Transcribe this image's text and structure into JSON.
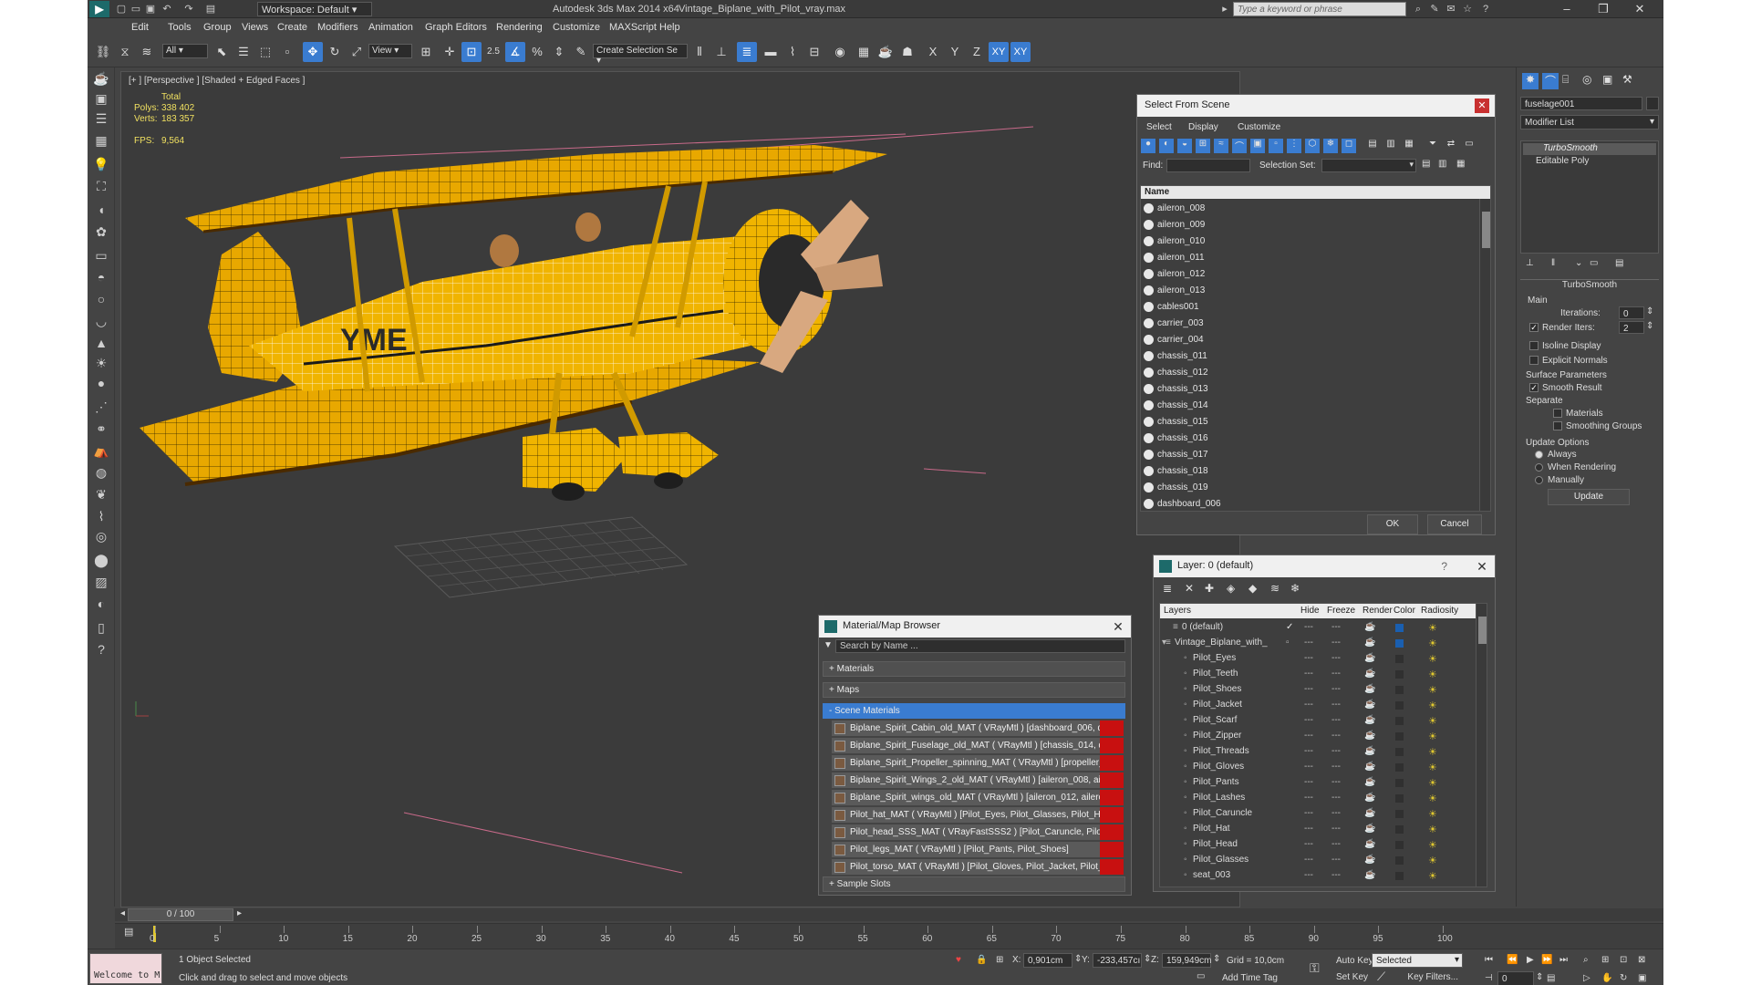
{
  "title_bar": {
    "workspace": "Workspace: Default",
    "app_title": "Autodesk 3ds Max  2014 x64",
    "file_name": "Vintage_Biplane_with_Pilot_vray.max",
    "search_placeholder": "Type a keyword or phrase"
  },
  "menu": [
    "Edit",
    "Tools",
    "Group",
    "Views",
    "Create",
    "Modifiers",
    "Animation",
    "Graph Editors",
    "Rendering",
    "Customize",
    "MAXScript",
    "Help"
  ],
  "toolbar": {
    "filter": "All",
    "ref_coord": "View",
    "snap_value": "2.5",
    "named_set": "Create Selection Se",
    "axis_labels": [
      "X",
      "Y",
      "Z",
      "XY",
      "XY"
    ]
  },
  "viewport": {
    "label": "[+ ] [Perspective ] [Shaded + Edged Faces ]",
    "stats": {
      "total_label": "Total",
      "polys_label": "Polys:",
      "polys": "338 402",
      "verts_label": "Verts:",
      "verts": "183 357",
      "fps_label": "FPS:",
      "fps": "9,564"
    },
    "hull_text": "YME"
  },
  "select_from_scene": {
    "title": "Select From Scene",
    "menu": [
      "Select",
      "Display",
      "Customize"
    ],
    "find_label": "Find:",
    "selection_set_label": "Selection Set:",
    "column": "Name",
    "items": [
      "aileron_008",
      "aileron_009",
      "aileron_010",
      "aileron_011",
      "aileron_012",
      "aileron_013",
      "cables001",
      "carrier_003",
      "carrier_004",
      "chassis_011",
      "chassis_012",
      "chassis_013",
      "chassis_014",
      "chassis_015",
      "chassis_016",
      "chassis_017",
      "chassis_018",
      "chassis_019",
      "dashboard_006"
    ],
    "ok": "OK",
    "cancel": "Cancel"
  },
  "layer_dialog": {
    "title": "Layer: 0 (default)",
    "help": "?",
    "columns": [
      "Layers",
      "Hide",
      "Freeze",
      "Render",
      "Color",
      "Radiosity"
    ],
    "rows": [
      "0 (default)",
      "Vintage_Biplane_with_",
      "Pilot_Eyes",
      "Pilot_Teeth",
      "Pilot_Shoes",
      "Pilot_Jacket",
      "Pilot_Scarf",
      "Pilot_Zipper",
      "Pilot_Threads",
      "Pilot_Gloves",
      "Pilot_Pants",
      "Pilot_Lashes",
      "Pilot_Caruncle",
      "Pilot_Hat",
      "Pilot_Head",
      "Pilot_Glasses",
      "seat_003"
    ]
  },
  "material_browser": {
    "title": "Material/Map Browser",
    "search_placeholder": "Search by Name ...",
    "sections": [
      "+ Materials",
      "+ Maps",
      "- Scene Materials",
      "+ Sample Slots"
    ],
    "materials": [
      "Biplane_Spirit_Cabin_old_MAT ( VRayMtl ) [dashboard_006, d...",
      "Biplane_Spirit_Fuselage_old_MAT ( VRayMtl ) [chassis_014, d...",
      "Biplane_Spirit_Propeller_spinning_MAT ( VRayMtl ) [propeller_...",
      "Biplane_Spirit_Wings_2_old_MAT ( VRayMtl ) [aileron_008, ail...",
      "Biplane_Spirit_wings_old_MAT ( VRayMtl ) [aileron_012, ailero...",
      "Pilot_hat_MAT ( VRayMtl ) [Pilot_Eyes, Pilot_Glasses, Pilot_Ha...",
      "Pilot_head_SSS_MAT ( VRayFastSSS2 ) [Pilot_Caruncle, Pilot_...",
      "Pilot_legs_MAT ( VRayMtl ) [Pilot_Pants, Pilot_Shoes]",
      "Pilot_torso_MAT ( VRayMtl ) [Pilot_Gloves, Pilot_Jacket, Pilot_..."
    ]
  },
  "command_panel": {
    "object_name": "fuselage001",
    "modifier_list": "Modifier List",
    "stack": [
      "TurboSmooth",
      "Editable Poly"
    ],
    "rollout_title": "TurboSmooth",
    "main_label": "Main",
    "iterations_label": "Iterations:",
    "iterations": "0",
    "render_iters_label": "Render Iters:",
    "render_iters": "2",
    "isoline": "Isoline Display",
    "explicit_normals": "Explicit Normals",
    "surface_params": "Surface Parameters",
    "smooth_result": "Smooth Result",
    "separate": "Separate",
    "materials": "Materials",
    "smoothing_groups": "Smoothing Groups",
    "update_options": "Update Options",
    "always": "Always",
    "when_rendering": "When Rendering",
    "manually": "Manually",
    "update_button": "Update"
  },
  "timeline": {
    "frame": "0 / 100",
    "ticks": [
      "0",
      "5",
      "10",
      "15",
      "20",
      "25",
      "30",
      "35",
      "40",
      "45",
      "50",
      "55",
      "60",
      "65",
      "70",
      "75",
      "80",
      "85",
      "90",
      "95",
      "100"
    ]
  },
  "status": {
    "maxscript": "Welcome to M",
    "selection": "1 Object Selected",
    "prompt": "Click and drag to select and move objects",
    "x_label": "X:",
    "x": "0,901cm",
    "y_label": "Y:",
    "y": "-233,457cı",
    "z_label": "Z:",
    "z": "159,949cm",
    "grid": "Grid = 10,0cm",
    "add_time_tag": "Add Time Tag",
    "auto_key": "Auto Key",
    "set_key": "Set Key",
    "selected_dropdown": "Selected",
    "key_filters": "Key Filters...",
    "frame_field": "0"
  }
}
